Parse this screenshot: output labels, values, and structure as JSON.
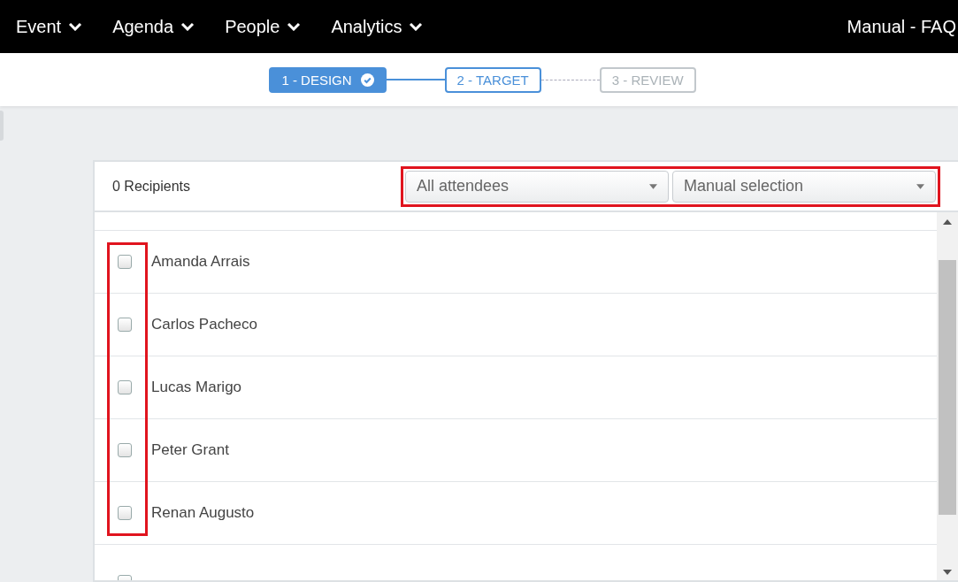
{
  "nav": {
    "menus": [
      {
        "label": "Event"
      },
      {
        "label": "Agenda"
      },
      {
        "label": "People"
      },
      {
        "label": "Analytics"
      }
    ],
    "right_link": "Manual - FAQ"
  },
  "steps": [
    {
      "label": "1 - DESIGN",
      "completed": true,
      "selected": false
    },
    {
      "label": "2 - TARGET",
      "completed": false,
      "selected": true
    },
    {
      "label": "3 - REVIEW",
      "completed": false,
      "selected": false
    }
  ],
  "panel": {
    "recipients": "0 Recipients",
    "filters": [
      {
        "value": "All attendees"
      },
      {
        "value": "Manual selection"
      }
    ],
    "people": [
      {
        "name": "Amanda Arrais",
        "checked": false
      },
      {
        "name": "Carlos Pacheco",
        "checked": false
      },
      {
        "name": "Lucas Marigo",
        "checked": false
      },
      {
        "name": "Peter Grant",
        "checked": false
      },
      {
        "name": "Renan Augusto",
        "checked": false
      }
    ],
    "cut_row": {
      "checked": false
    }
  }
}
